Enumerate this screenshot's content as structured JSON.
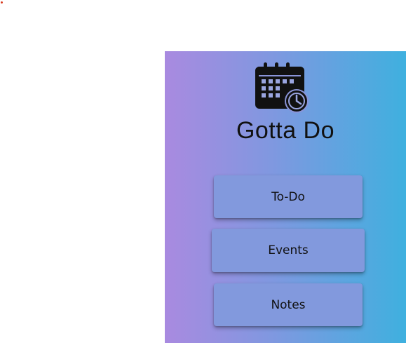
{
  "app": {
    "name": "Gotta Do"
  },
  "logo": {
    "icon": "calendar-clock-icon"
  },
  "nav": {
    "items": [
      {
        "label": "To-Do"
      },
      {
        "label": "Events"
      },
      {
        "label": "Notes"
      }
    ]
  },
  "colors": {
    "gradient_start": "#a98ae0",
    "gradient_end": "#3fb0df",
    "button_bg": "#8299dd",
    "marker": "#d93a1f"
  }
}
